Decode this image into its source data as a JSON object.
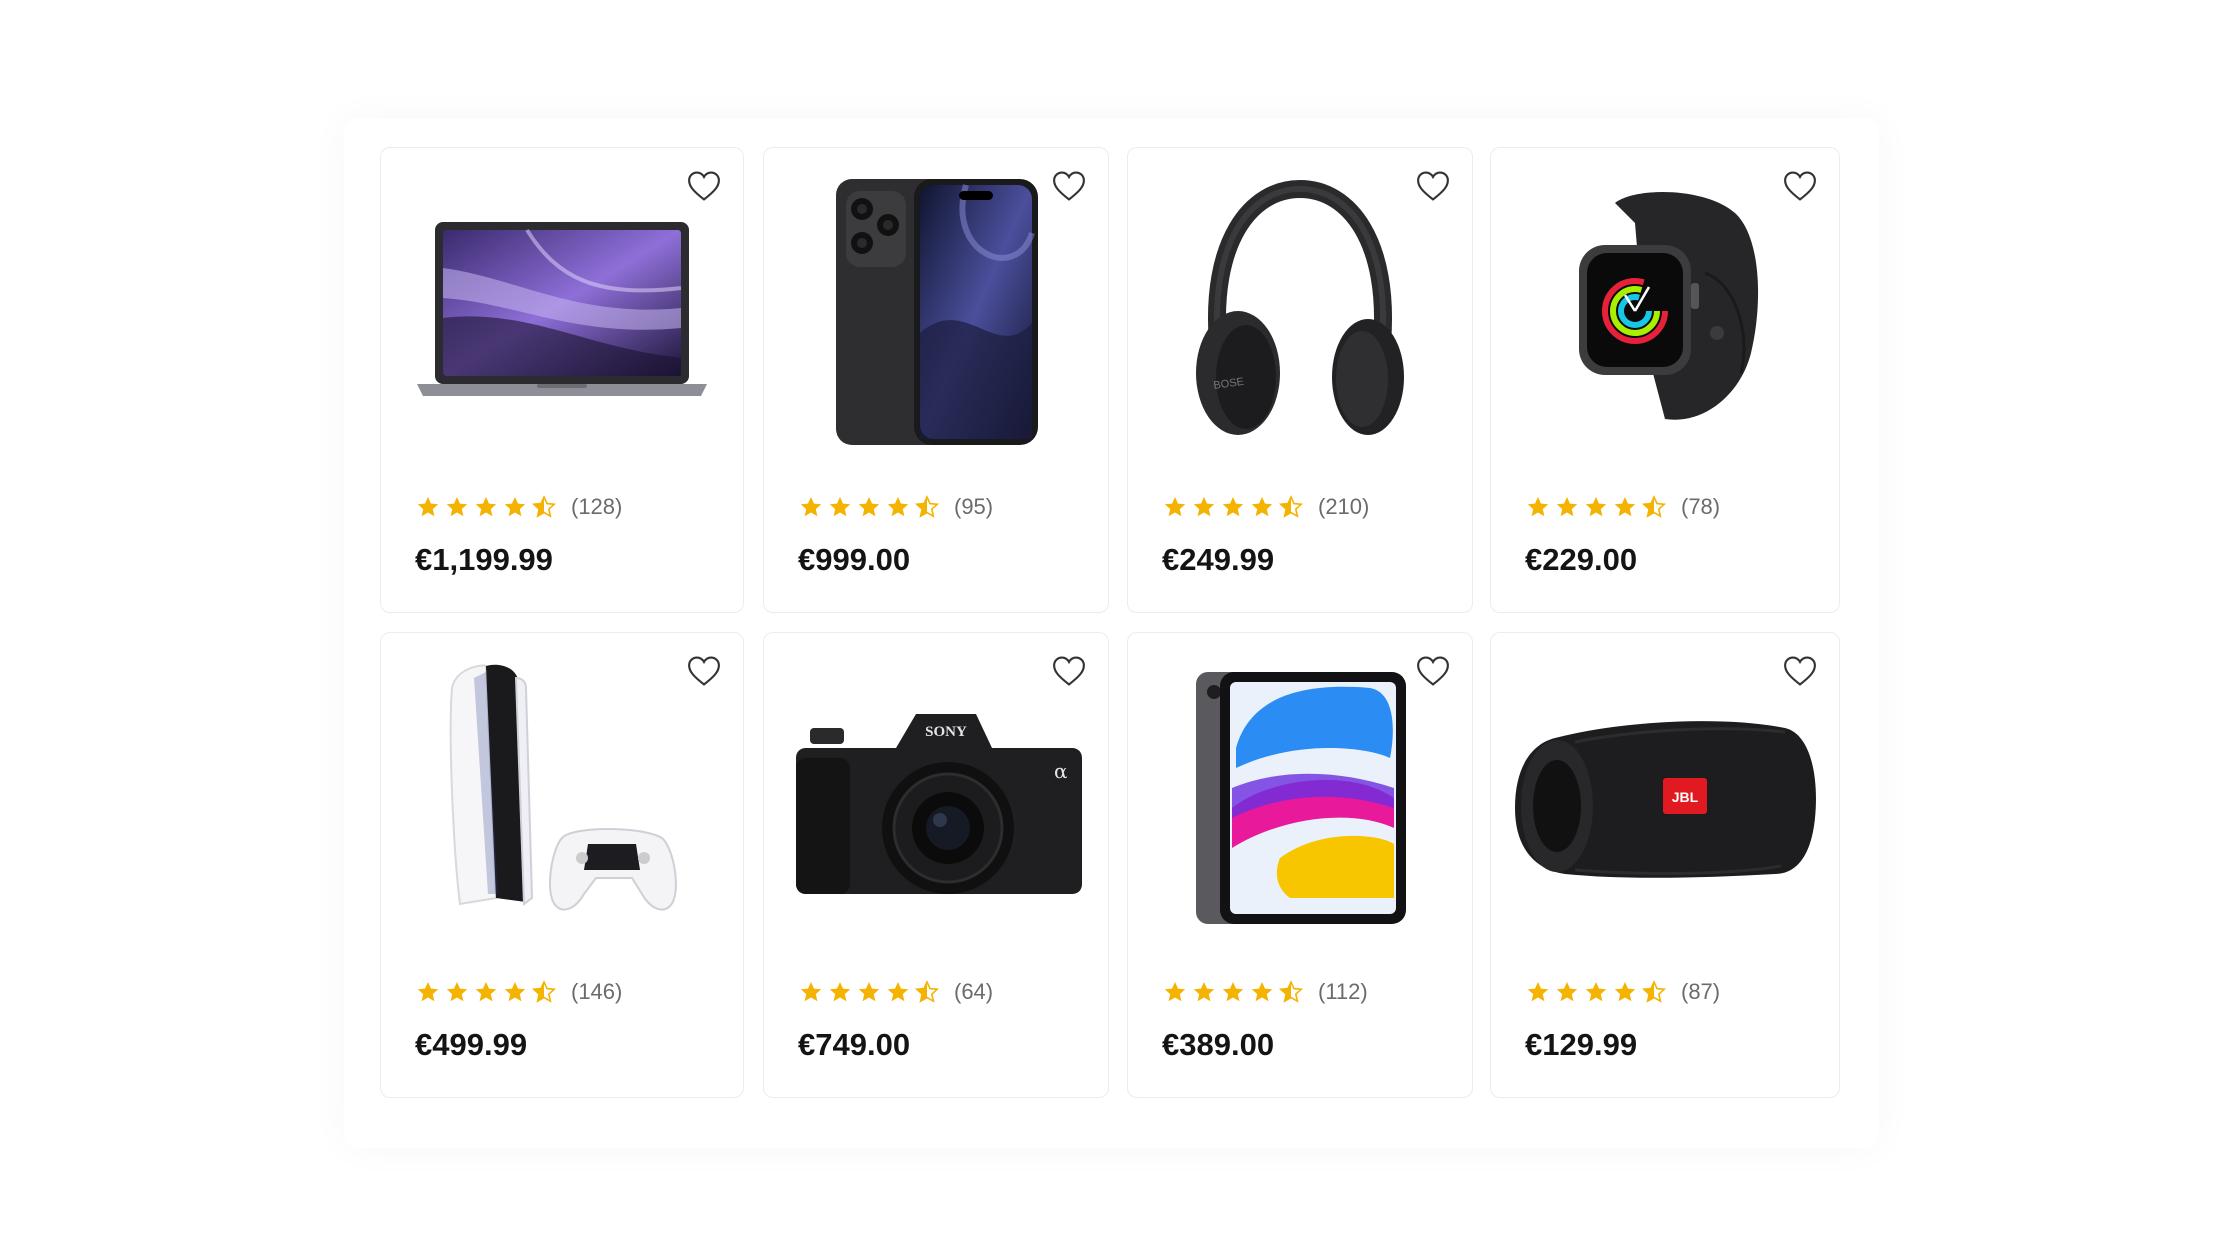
{
  "colors": {
    "star": "#F5B301",
    "price": "#141414",
    "count": "#6b6b6b"
  },
  "icons": {
    "favorite": "heart-outline-icon",
    "rating": "star-icon"
  },
  "products": [
    {
      "image": "laptop",
      "rating": 4.5,
      "reviews": "(128)",
      "price": "€1,199.99"
    },
    {
      "image": "smartphone",
      "rating": 4.5,
      "reviews": "(95)",
      "price": "€999.00"
    },
    {
      "image": "headphones",
      "rating": 4.5,
      "reviews": "(210)",
      "price": "€249.99"
    },
    {
      "image": "smartwatch",
      "rating": 4.5,
      "reviews": "(78)",
      "price": "€229.00"
    },
    {
      "image": "game-console",
      "rating": 4.5,
      "reviews": "(146)",
      "price": "€499.99"
    },
    {
      "image": "camera",
      "rating": 4.5,
      "reviews": "(64)",
      "price": "€749.00"
    },
    {
      "image": "tablet",
      "rating": 4.5,
      "reviews": "(112)",
      "price": "€389.00"
    },
    {
      "image": "speaker",
      "rating": 4.5,
      "reviews": "(87)",
      "price": "€129.99"
    }
  ],
  "brands": {
    "camera": "SONY",
    "speaker": "JBL",
    "headphones": "BOSE"
  }
}
